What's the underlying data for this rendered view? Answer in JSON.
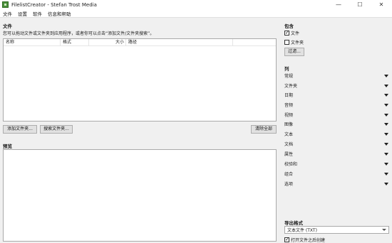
{
  "window": {
    "title": "FilelistCreator - Stefan Trost Media",
    "minimize": "—",
    "maximize": "☐",
    "close": "✕"
  },
  "menu": [
    "文件",
    "设置",
    "软件",
    "信息和帮助"
  ],
  "files": {
    "title": "文件",
    "hint": "您可以拖动文件或文件夹到应用程序，或者你可以点击“添加文件/文件夹搜索”。",
    "columns": [
      "名称",
      "格式",
      "大小",
      "路径"
    ],
    "add_button": "添加文件夹...",
    "search_button": "搜索文件夹...",
    "clear_button": "清除全部"
  },
  "preview": {
    "title": "预览"
  },
  "include": {
    "title": "包含",
    "files_label": "文件",
    "files_checked": true,
    "folders_label": "文件夹",
    "folders_checked": false,
    "filter_button": "过滤..."
  },
  "columns_panel": {
    "title": "列",
    "items": [
      "常规",
      "文件夹",
      "日期",
      "音频",
      "视频",
      "图像",
      "文本",
      "文档",
      "属性",
      "校验和",
      "组合",
      "选项"
    ]
  },
  "export": {
    "title": "导出格式",
    "selected": "文本文件 (TXT)",
    "open_after_label": "打开文件之后创建",
    "open_after_checked": true
  }
}
